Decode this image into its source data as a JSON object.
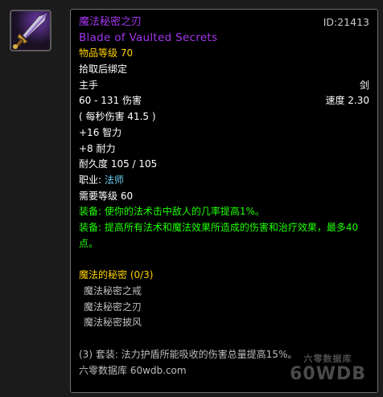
{
  "item": {
    "icon": "sword-icon",
    "name_zh": "魔法秘密之刃",
    "id_label": "ID:21413",
    "name_en": "Blade of Vaulted Secrets",
    "item_level": "物品等级 70",
    "bind": "拾取后绑定",
    "slot": "主手",
    "type": "剑",
    "damage": "60 - 131 伤害",
    "speed": "速度 2.30",
    "dps": "( 每秒伤害 41.5 )",
    "stat1": "+16 智力",
    "stat2": "+8 耐力",
    "durability": "耐久度 105 / 105",
    "class_label": "职业: ",
    "class_value": "法师",
    "req_level": "需要等级 60",
    "equip1": "装备: 使你的法术击中敌人的几率提高1%。",
    "equip2": "装备: 提高所有法术和魔法效果所造成的伤害和治疗效果，最多40点。"
  },
  "set": {
    "name": "魔法的秘密 (0/3)",
    "pieces": [
      "魔法秘密之戒",
      "魔法秘密之刃",
      "魔法秘密披风"
    ],
    "bonus": "(3) 套装: 法力护盾所能吸收的伤害总量提高15%。"
  },
  "source": "六零数据库 60wdb.com",
  "watermark": {
    "top": "六零数据库",
    "big": "60WDB"
  },
  "colors": {
    "epic": "#a335ee",
    "yellow": "#ffd100",
    "green": "#1eff00",
    "mage": "#69ccf0"
  }
}
